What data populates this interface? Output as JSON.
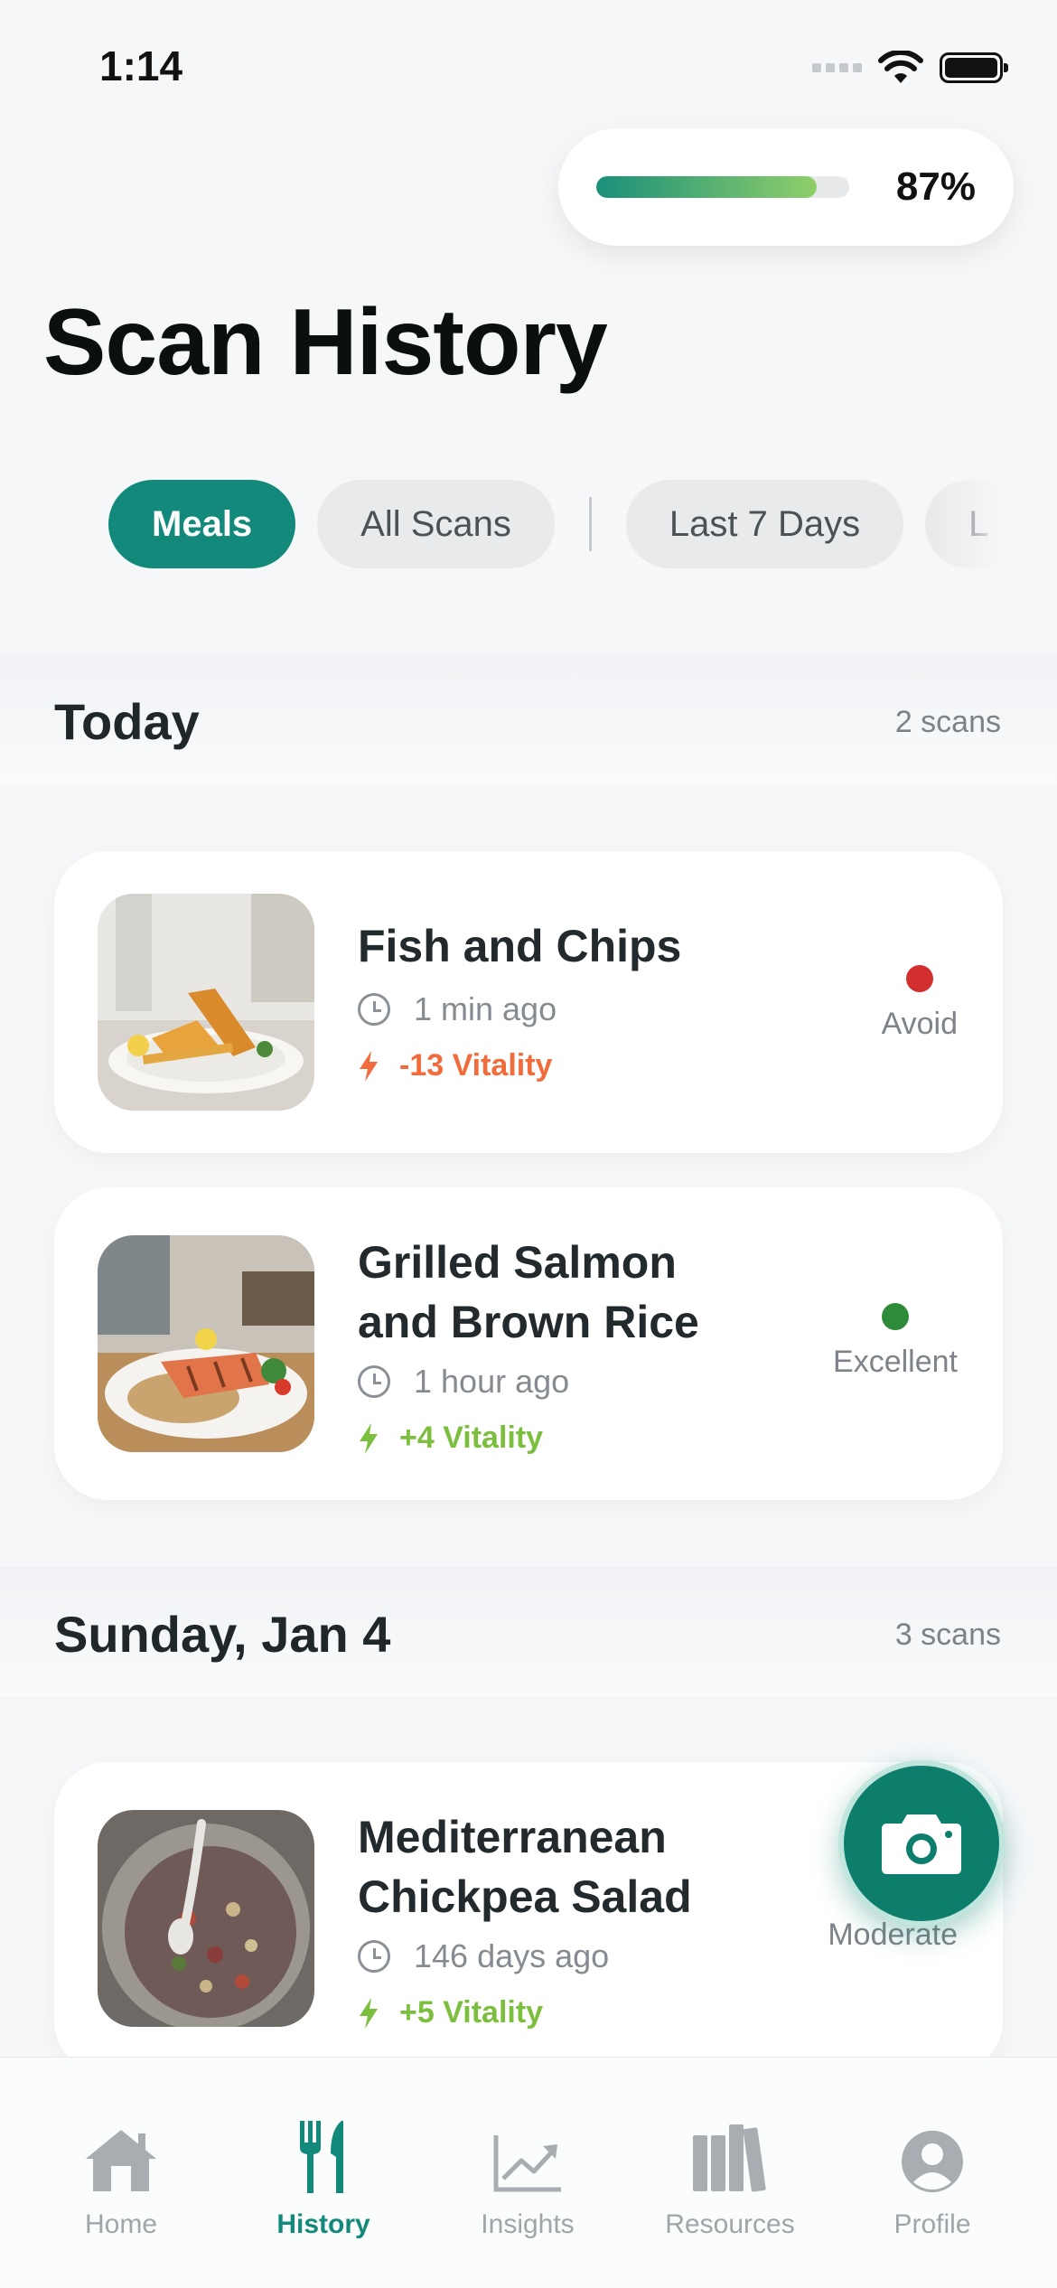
{
  "status_bar": {
    "time": "1:14"
  },
  "vitality": {
    "value_label": "87%",
    "fraction": 0.87
  },
  "page": {
    "title": "Scan History"
  },
  "filters": {
    "chips": [
      "Meals",
      "All Scans",
      "Last 7 Days",
      "L"
    ],
    "active": "Meals"
  },
  "sections": [
    {
      "title": "Today",
      "count": "2 scans",
      "meals": [
        {
          "name_lines": [
            "Fish and Chips"
          ],
          "time": "1 min ago",
          "vitality": "-13 Vitality",
          "rating": "Avoid",
          "rating_color": "#d32f2f",
          "vitality_color": "#f26b3a"
        },
        {
          "name_lines": [
            "Grilled Salmon",
            "and Brown Rice"
          ],
          "time": "1 hour ago",
          "vitality": "+4 Vitality",
          "rating": "Excellent",
          "rating_color": "#2e8b3a",
          "vitality_color": "#7cbf3f"
        }
      ]
    },
    {
      "title": "Sunday, Jan 4",
      "count": "3 scans",
      "meals": [
        {
          "name_lines": [
            "Mediterranean",
            "Chickpea Salad"
          ],
          "time": "146 days ago",
          "vitality": "+5 Vitality",
          "rating": "Moderate",
          "vitality_color": "#7cbf3f"
        }
      ]
    }
  ],
  "peek": {
    "rating": "Moderate"
  },
  "tab_bar": {
    "tabs": [
      {
        "label": "Home",
        "icon": "house-icon"
      },
      {
        "label": "History",
        "icon": "fork-knife-icon"
      },
      {
        "label": "Insights",
        "icon": "chart-icon"
      },
      {
        "label": "Resources",
        "icon": "books-icon"
      },
      {
        "label": "Profile",
        "icon": "person-icon"
      }
    ],
    "active": "History"
  },
  "colors": {
    "accent": "#12897a",
    "fab": "#0d7d6c",
    "avoid": "#d32f2f",
    "excellent": "#2e8b3a"
  }
}
